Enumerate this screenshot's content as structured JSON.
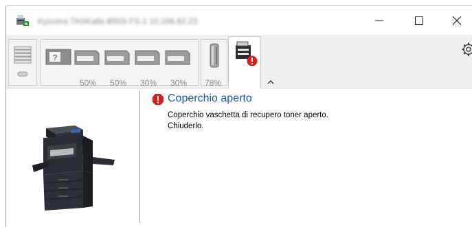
{
  "window": {
    "title": "Kyocera TASKalfa 8003i FS-1 10.166.82.23",
    "icons": {
      "app": "printer-app-icon",
      "minimize": "minimize-icon",
      "maximize": "maximize-icon",
      "close": "close-icon"
    }
  },
  "toolbar": {
    "paper": {
      "icon": "paper-stack-icon"
    },
    "trays": [
      {
        "icon": "manual-feed-unknown-icon",
        "level": ""
      },
      {
        "icon": "paper-tray-1-icon",
        "level": "50%"
      },
      {
        "icon": "paper-tray-2-icon",
        "level": "50%"
      },
      {
        "icon": "paper-tray-3-icon",
        "level": "30%"
      },
      {
        "icon": "paper-tray-4-icon",
        "level": "30%"
      }
    ],
    "toner": {
      "icon": "toner-icon",
      "level": "78%"
    },
    "status_tab": {
      "icon": "printer-error-icon"
    },
    "collapse_icon": "chevron-up-icon",
    "settings_icon": "gear-icon"
  },
  "status": {
    "title": "Coperchio aperto",
    "line1": "Coperchio vaschetta di recupero toner aperto.",
    "line2": "Chiuderlo.",
    "error_color": "#d42020",
    "title_color": "#1a56b8"
  }
}
